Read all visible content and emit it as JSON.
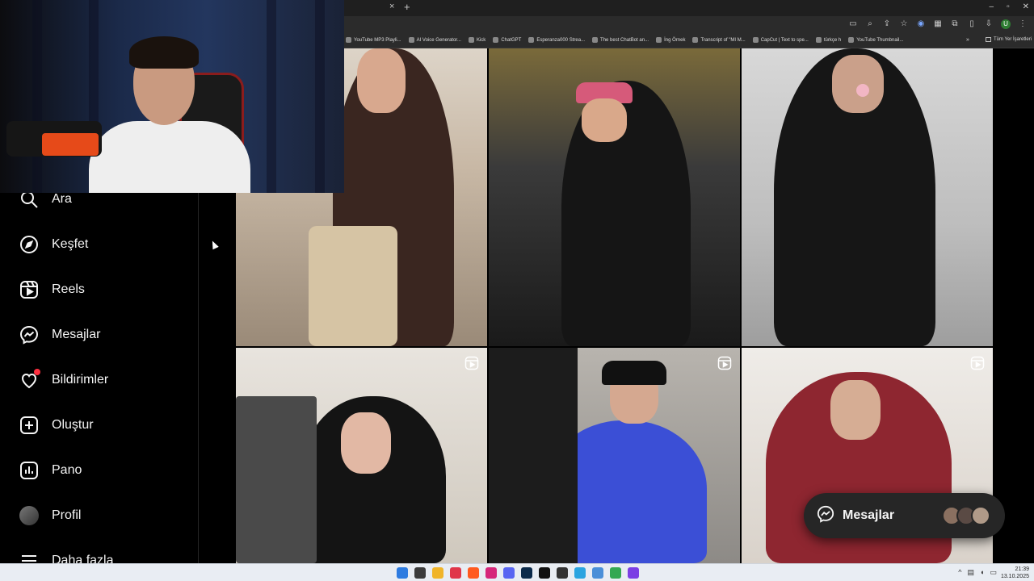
{
  "browser": {
    "tab_close": "×",
    "tab_new": "+",
    "window_controls": [
      "–",
      "▫",
      "✕"
    ],
    "bookmarks": [
      "YouTube MP3 Playli...",
      "AI Voice Generator...",
      "Kick",
      "ChatGPT",
      "Esperanza000 Strea...",
      "The best ChatBot an...",
      "İng Örnek",
      "Transcript of \"MI M...",
      "CapCut | Text to spe...",
      "türkçe h",
      "YouTube Thumbnail..."
    ],
    "bookmarks_more": "»",
    "all_bookmarks": "Tüm Yer İşaretleri",
    "profile_initial": "U"
  },
  "sidebar": {
    "items": [
      {
        "label": "Ara",
        "icon": "search-icon"
      },
      {
        "label": "Keşfet",
        "icon": "compass-icon"
      },
      {
        "label": "Reels",
        "icon": "reels-icon"
      },
      {
        "label": "Mesajlar",
        "icon": "messenger-icon"
      },
      {
        "label": "Bildirimler",
        "icon": "heart-icon"
      },
      {
        "label": "Oluştur",
        "icon": "plus-square-icon"
      },
      {
        "label": "Pano",
        "icon": "chart-icon"
      },
      {
        "label": "Profil",
        "icon": "profile-avatar"
      },
      {
        "label": "Daha fazla",
        "icon": "menu-icon"
      }
    ]
  },
  "messages_popup": {
    "label": "Mesajlar",
    "icon": "messenger-icon"
  },
  "taskbar": {
    "time": "21:39",
    "date": "13.10.2025"
  },
  "colors": {
    "notification": "#ff3040",
    "popup_bg": "#262626",
    "sidebar_bg": "#000000"
  }
}
